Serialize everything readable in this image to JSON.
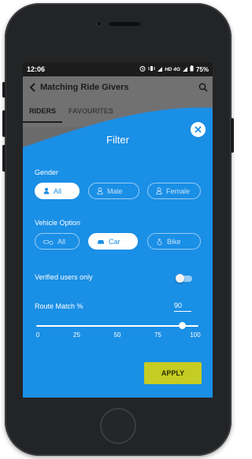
{
  "status_bar": {
    "time": "12:06",
    "network_label": "HD 4G",
    "battery": "75%"
  },
  "app_bar": {
    "title": "Matching Ride Givers"
  },
  "tabs": [
    {
      "label": "RIDERS",
      "active": true
    },
    {
      "label": "FAVOURITES",
      "active": false
    }
  ],
  "filter": {
    "title": "Filter",
    "gender": {
      "label": "Gender",
      "options": [
        {
          "label": "All",
          "icon": "person-icon",
          "selected": true
        },
        {
          "label": "Male",
          "icon": "person-icon",
          "selected": false
        },
        {
          "label": "Female",
          "icon": "person-icon",
          "selected": false
        }
      ]
    },
    "vehicle": {
      "label": "Vehicle Option",
      "options": [
        {
          "label": "All",
          "icon": "car-bike-icon",
          "selected": false
        },
        {
          "label": "Car",
          "icon": "car-icon",
          "selected": true
        },
        {
          "label": "Bike",
          "icon": "bike-icon",
          "selected": false
        }
      ]
    },
    "verified": {
      "label": "Verified users only",
      "enabled": false
    },
    "route_match": {
      "label": "Route Match %",
      "value": "90",
      "slider_fraction": 0.9,
      "ticks": [
        "0",
        "25",
        "50",
        "75",
        "100"
      ]
    },
    "apply_label": "APPLY"
  },
  "colors": {
    "modal_blue": "#1a8fe6",
    "apply_bg": "#c5cc23",
    "overlay_gray": "#717171"
  }
}
